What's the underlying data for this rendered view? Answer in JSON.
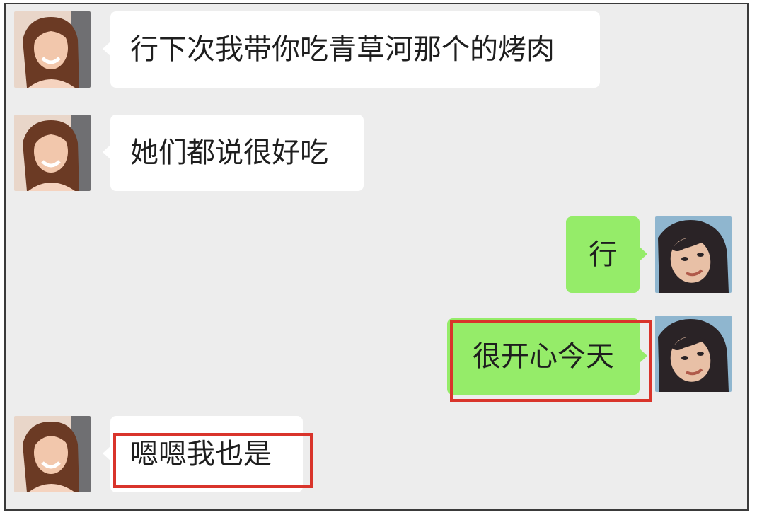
{
  "chat": {
    "messages": [
      {
        "side": "left",
        "text": "行下次我带你吃青草河那个的烤肉",
        "avatar_icon": "female-contact-avatar"
      },
      {
        "side": "left",
        "text": "她们都说很好吃",
        "avatar_icon": "female-contact-avatar"
      },
      {
        "side": "right",
        "text": "行",
        "avatar_icon": "self-user-avatar"
      },
      {
        "side": "right",
        "text": "很开心今天",
        "avatar_icon": "self-user-avatar",
        "highlighted": true
      },
      {
        "side": "left",
        "text": "嗯嗯我也是",
        "avatar_icon": "female-contact-avatar",
        "highlighted": true
      }
    ]
  },
  "colors": {
    "background": "#ededed",
    "incoming_bubble": "#ffffff",
    "outgoing_bubble": "#95ec69",
    "highlight_box": "#d9342b"
  }
}
